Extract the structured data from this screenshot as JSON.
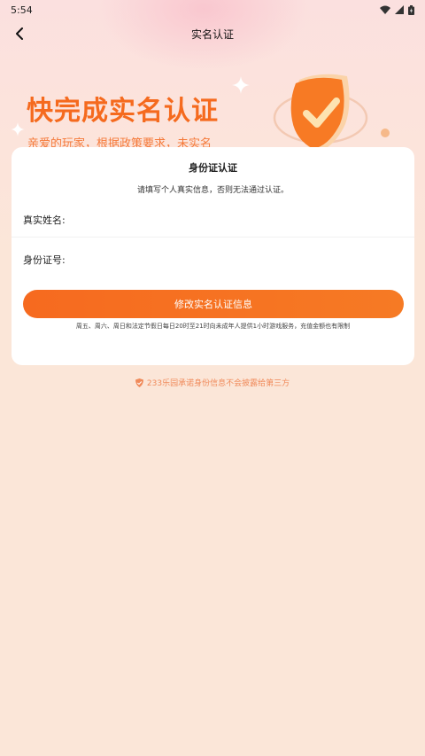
{
  "status_bar": {
    "time": "5:54",
    "icons": [
      "wifi-icon",
      "signal-icon",
      "battery-icon"
    ]
  },
  "nav": {
    "title": "实名认证",
    "back_icon": "chevron-left-icon"
  },
  "hero": {
    "title": "快完成实名认证",
    "subtitle": "亲爱的玩家，根据政策要求，未实名"
  },
  "card": {
    "title": "身份证认证",
    "description": "请填写个人真实信息，否则无法通过认证。",
    "name_label": "真实姓名:",
    "name_value": "",
    "id_label": "身份证号:",
    "id_value": "",
    "submit_label": "修改实名认证信息",
    "notice": "周五、周六、周日和法定节假日每日20时至21时向未成年人提供1小时游戏服务，充值金额也有限制"
  },
  "privacy": {
    "icon": "shield-icon",
    "text": "233乐园承诺身份信息不会披露给第三方"
  },
  "colors": {
    "accent": "#f56a1e",
    "background": "#fbe6d8",
    "privacy_text": "#f08a5a"
  }
}
